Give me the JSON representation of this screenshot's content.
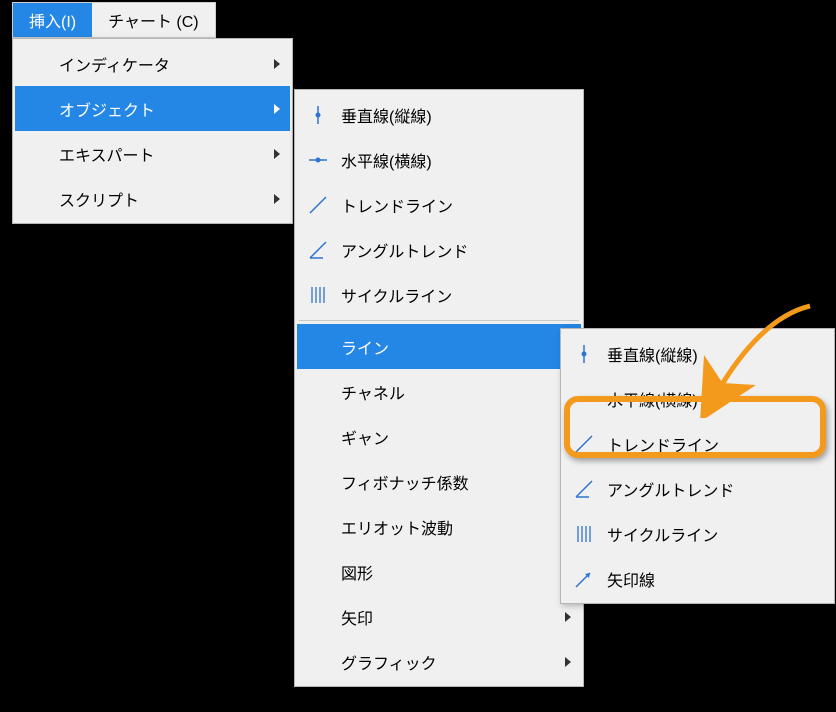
{
  "menubar": {
    "insert": "挿入(I)",
    "chart": "チャート (C)"
  },
  "menu1": {
    "indicator": "インディケータ",
    "object": "オブジェクト",
    "expert": "エキスパート",
    "script": "スクリプト"
  },
  "menu2": {
    "vertical": "垂直線(縦線)",
    "horizontal": "水平線(横線)",
    "trendline": "トレンドライン",
    "angle_trend": "アングルトレンド",
    "cycle": "サイクルライン",
    "line": "ライン",
    "channel": "チャネル",
    "gann": "ギャン",
    "fibo": "フィボナッチ係数",
    "elliott": "エリオット波動",
    "shape": "図形",
    "arrow": "矢印",
    "graphic": "グラフィック"
  },
  "menu3": {
    "vertical": "垂直線(縦線)",
    "horizontal": "水平線(横線)",
    "trendline": "トレンドライン",
    "angle_trend": "アングルトレンド",
    "cycle": "サイクルライン",
    "arrow_line": "矢印線"
  },
  "colors": {
    "accent": "#2487e6",
    "highlight": "#f39a1c"
  }
}
